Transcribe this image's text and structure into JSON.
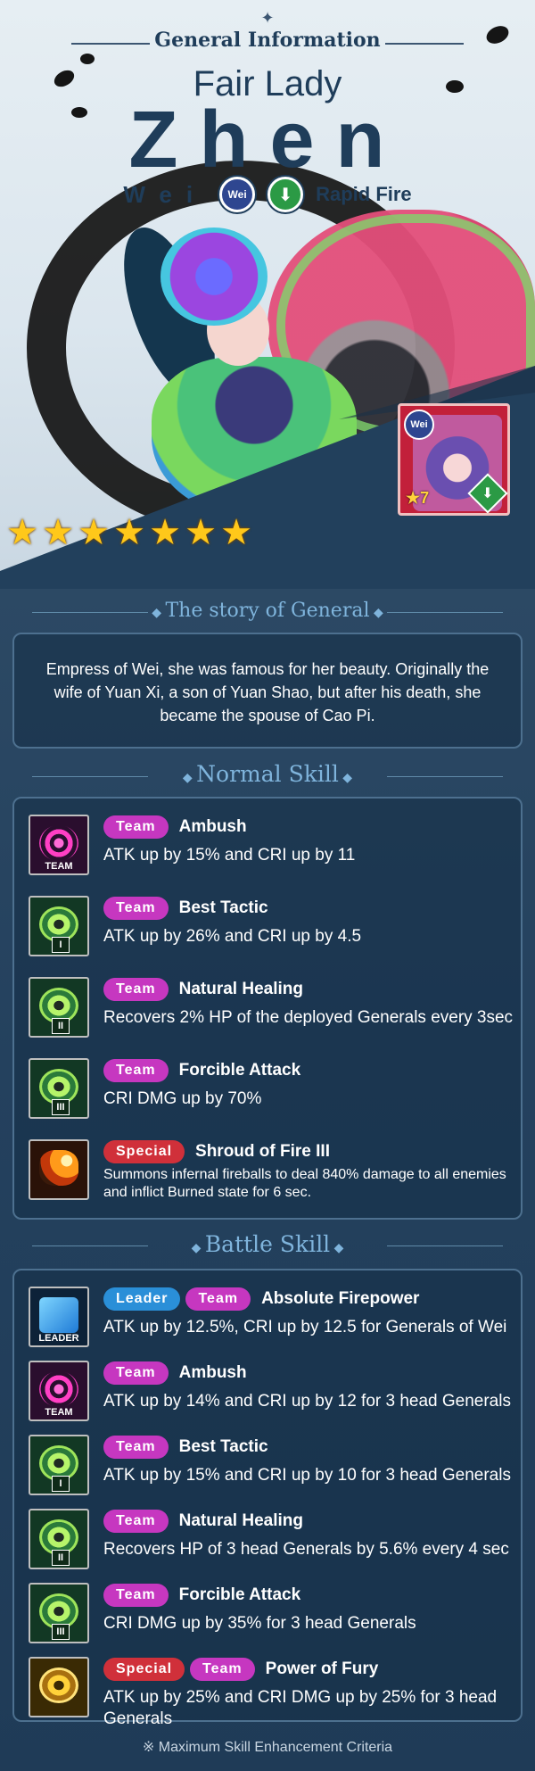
{
  "header": {
    "section_label": "General Information",
    "title": "Fair Lady",
    "name": "Zhen",
    "faction": "Wei",
    "faction_badge": "Wei",
    "attack_type": "Rapid Fire"
  },
  "portrait": {
    "faction_badge": "Wei",
    "star_level": "★7"
  },
  "star_count": 7,
  "story": {
    "title": "The story of General",
    "text": "Empress of Wei, she was famous for her beauty. Originally the wife of Yuan Xi, a son of Yuan Shao, but after his death, she became the spouse of Cao Pi."
  },
  "normal_skill": {
    "title": "Normal Skill",
    "skills": [
      {
        "tags": [
          "Team"
        ],
        "name": "Ambush",
        "desc": "ATK up by 15% and CRI up by 11",
        "icon": "target-team-icon",
        "icon_tag": "TEAM"
      },
      {
        "tags": [
          "Team"
        ],
        "name": "Best Tactic",
        "desc": "ATK up by 26% and CRI up by 4.5",
        "icon": "eye-tactic-icon",
        "icon_tag": "I"
      },
      {
        "tags": [
          "Team"
        ],
        "name": "Natural Healing",
        "desc": "Recovers 2% HP of the deployed Generals every 3sec",
        "icon": "eye-tactic-icon",
        "icon_tag": "II"
      },
      {
        "tags": [
          "Team"
        ],
        "name": "Forcible Attack",
        "desc": "CRI DMG up by 70%",
        "icon": "eye-tactic-icon",
        "icon_tag": "III"
      },
      {
        "tags": [
          "Special"
        ],
        "name": "Shroud of Fire III",
        "desc": "Summons infernal fireballs to deal 840% damage to all enemies and inflict Burned state for 6 sec.",
        "icon": "fireball-icon",
        "icon_tag": ""
      }
    ]
  },
  "battle_skill": {
    "title": "Battle Skill",
    "skills": [
      {
        "tags": [
          "Leader",
          "Team"
        ],
        "name": "Absolute Firepower",
        "desc": "ATK up by 12.5%, CRI up by 12.5 for Generals of Wei",
        "icon": "book-leader-icon",
        "icon_tag": "LEADER"
      },
      {
        "tags": [
          "Team"
        ],
        "name": "Ambush",
        "desc": "ATK up by 14% and CRI up by 12 for 3 head Generals",
        "icon": "target-team-icon",
        "icon_tag": "TEAM"
      },
      {
        "tags": [
          "Team"
        ],
        "name": "Best Tactic",
        "desc": "ATK up by 15% and CRI up by 10 for 3 head Generals",
        "icon": "eye-tactic-icon",
        "icon_tag": "I"
      },
      {
        "tags": [
          "Team"
        ],
        "name": "Natural Healing",
        "desc": "Recovers HP of 3 head Generals by 5.6% every 4 sec",
        "icon": "eye-tactic-icon",
        "icon_tag": "II"
      },
      {
        "tags": [
          "Team"
        ],
        "name": "Forcible Attack",
        "desc": "CRI DMG up by 35% for 3 head Generals",
        "icon": "eye-tactic-icon",
        "icon_tag": "III"
      },
      {
        "tags": [
          "Special",
          "Team"
        ],
        "name": "Power of Fury",
        "desc": "ATK up by 25% and CRI DMG up by 25% for 3 head Generals",
        "icon": "eye-fury-icon",
        "icon_tag": ""
      }
    ]
  },
  "footnote": "※ Maximum Skill Enhancement Criteria",
  "colors": {
    "team_pill": "#c637c0",
    "special_pill": "#d0303a",
    "leader_pill": "#2a8fd8",
    "title_navy": "#1f3d5a",
    "section_title": "#7fb4dc"
  }
}
